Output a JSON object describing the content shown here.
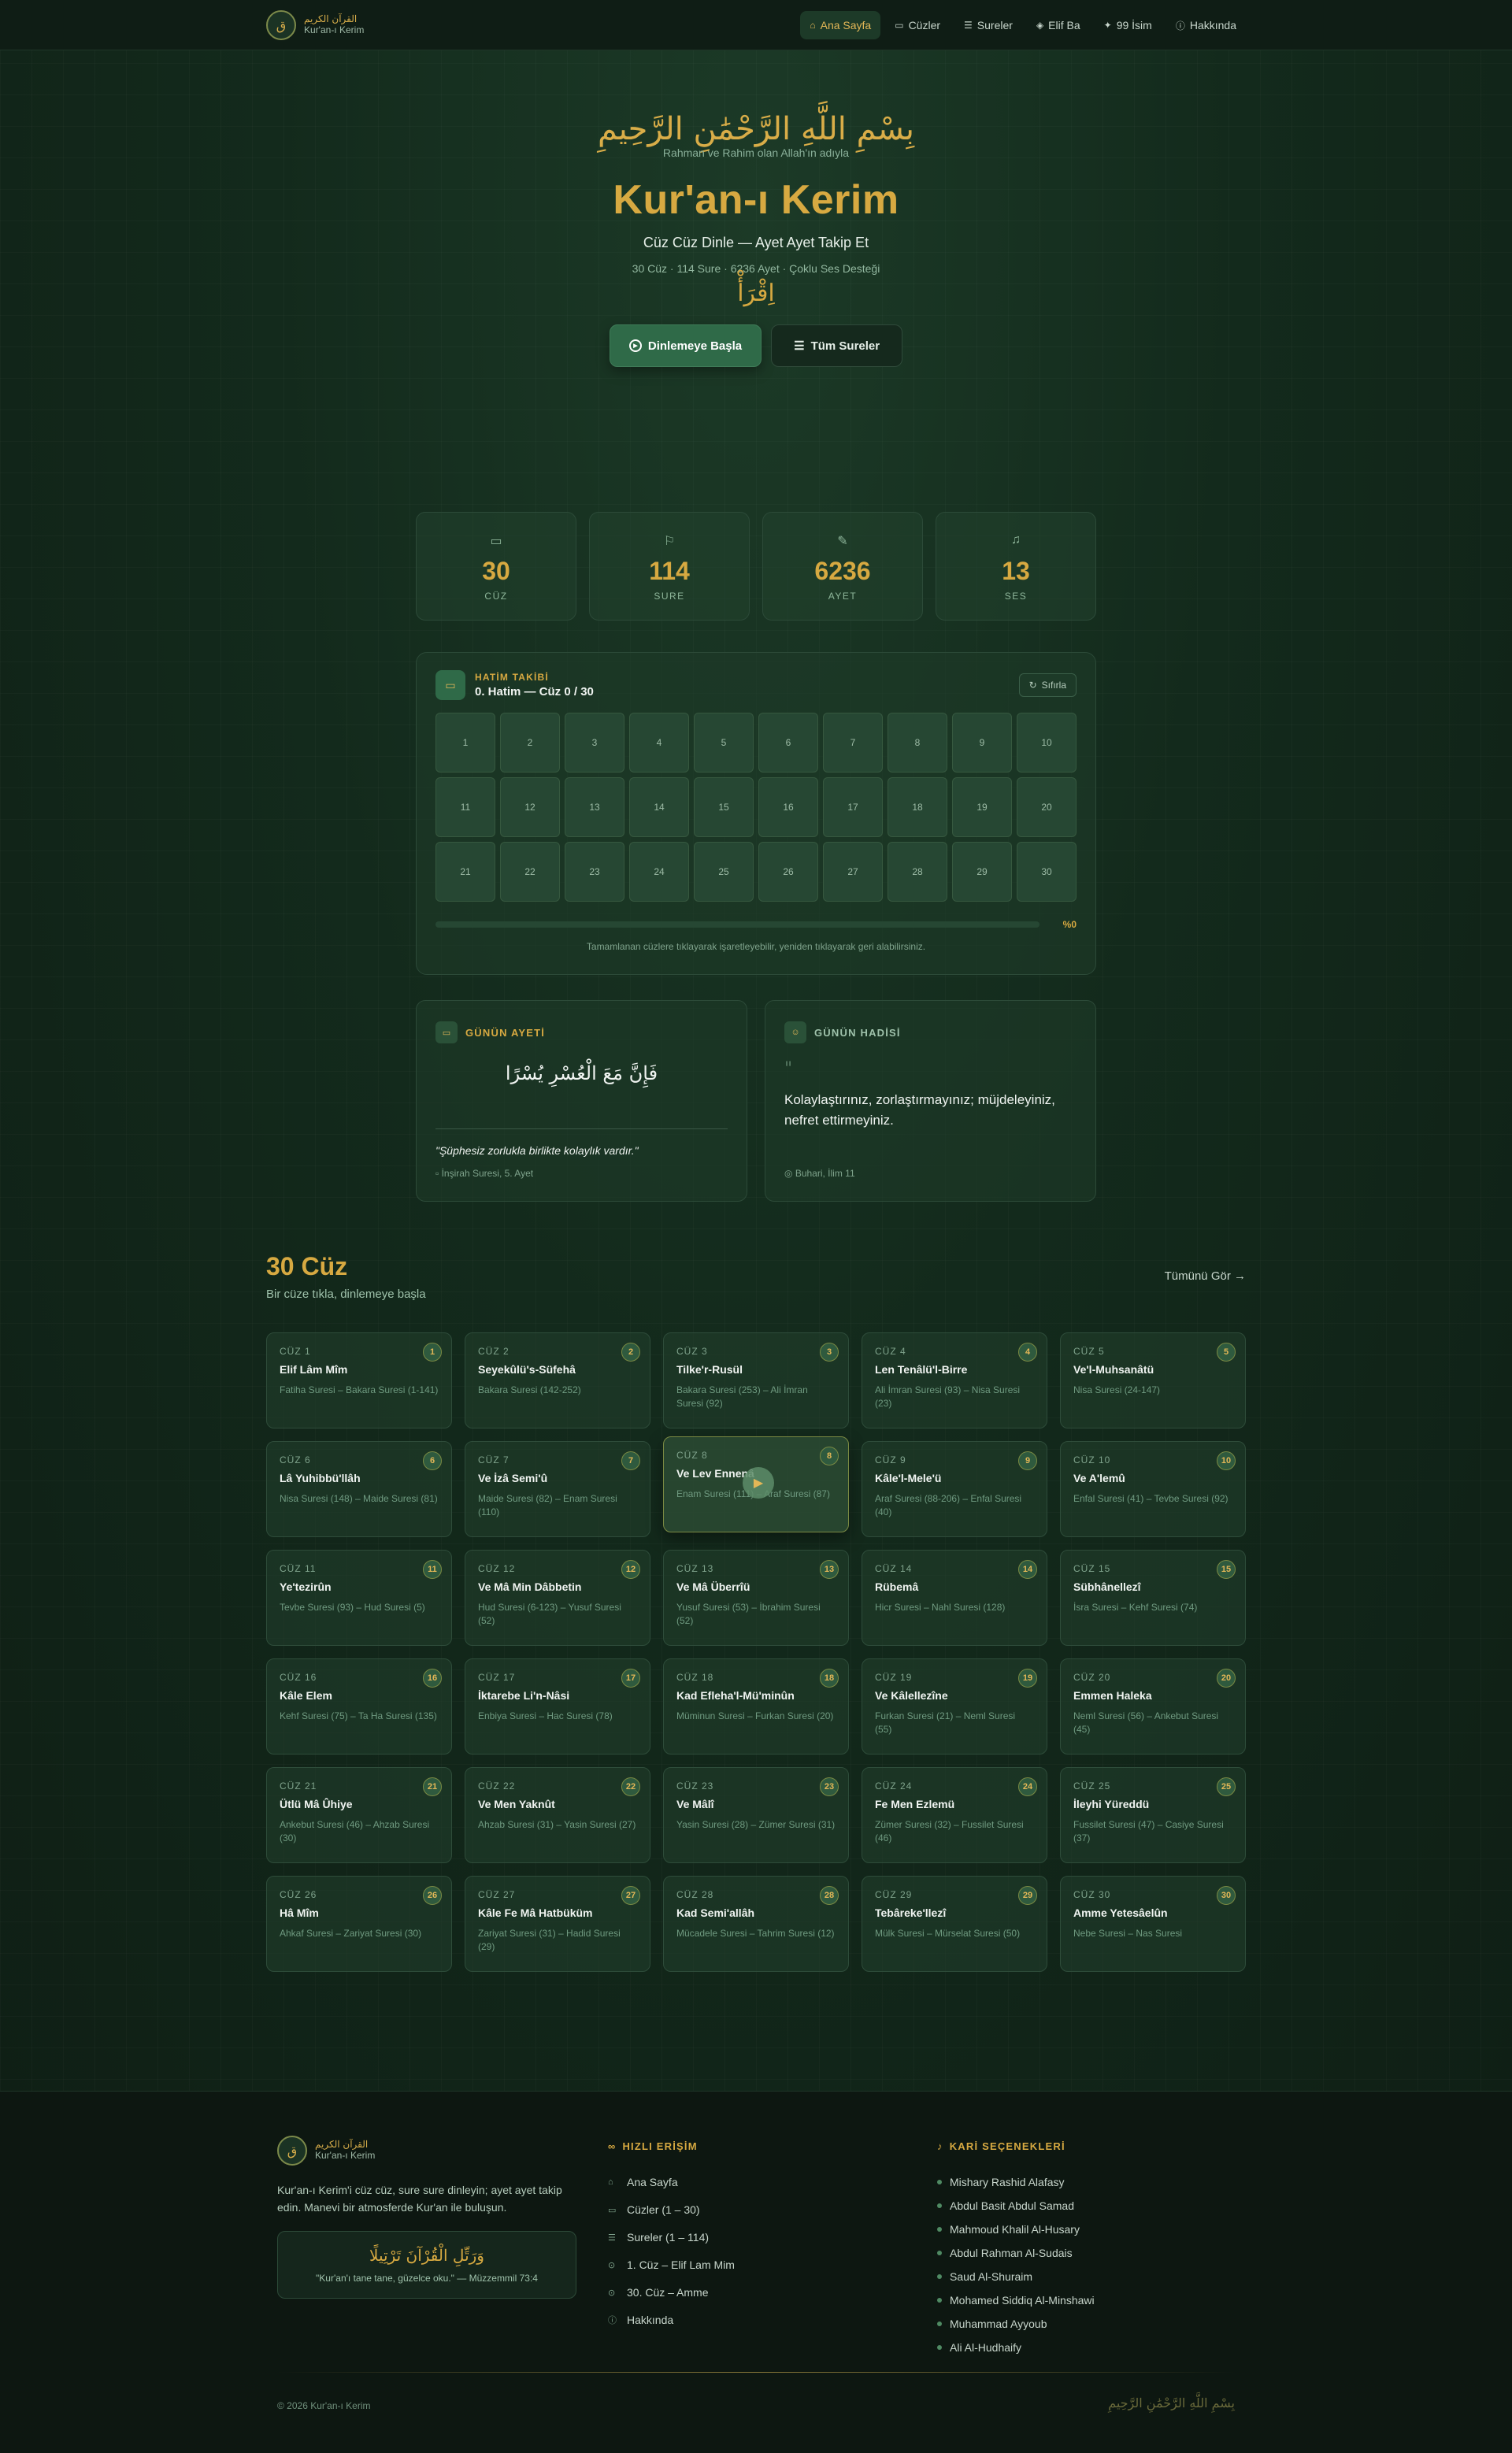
{
  "nav": {
    "brand_ar": "القرآن الكريم",
    "brand_tr": "Kur'an-ı Kerim",
    "logo_letter": "ق",
    "links": [
      {
        "label": "Ana Sayfa",
        "icon": "home-icon",
        "active": true
      },
      {
        "label": "Cüzler",
        "icon": "book-icon"
      },
      {
        "label": "Sureler",
        "icon": "list-icon"
      },
      {
        "label": "Elif Ba",
        "icon": "grad-cap-icon"
      },
      {
        "label": "99 İsim",
        "icon": "sparkles-icon"
      },
      {
        "label": "Hakkında",
        "icon": "info-icon"
      }
    ]
  },
  "hero": {
    "bismillah": "بِسْمِ اللَّهِ الرَّحْمَٰنِ الرَّحِيمِ",
    "bismillah_tr": "Rahman ve Rahim olan Allah'ın adıyla",
    "title": "Kur'an-ı Kerim",
    "subtitle": "Cüz Cüz Dinle — Ayet Ayet Takip Et",
    "stats_line": "30 Cüz · 114 Sure · 6236 Ayet · Çoklu Ses Desteği",
    "iqra": "اِقْرَأْ",
    "primary_button": "Dinlemeye Başla",
    "secondary_button": "Tüm Sureler"
  },
  "stats": [
    {
      "value": "30",
      "label": "CÜZ",
      "icon": "book-open-icon"
    },
    {
      "value": "114",
      "label": "SURE",
      "icon": "bookmark-icon"
    },
    {
      "value": "6236",
      "label": "AYET",
      "icon": "book-edit-icon"
    },
    {
      "value": "13",
      "label": "SES",
      "icon": "microphone-icon"
    }
  ],
  "hatim": {
    "kicker": "HATİM TAKİBİ",
    "title": "0. Hatim — Cüz 0 / 30",
    "reset_label": "Sıfırla",
    "cells": [
      "1",
      "2",
      "3",
      "4",
      "5",
      "6",
      "7",
      "8",
      "9",
      "10",
      "11",
      "12",
      "13",
      "14",
      "15",
      "16",
      "17",
      "18",
      "19",
      "20",
      "21",
      "22",
      "23",
      "24",
      "25",
      "26",
      "27",
      "28",
      "29",
      "30"
    ],
    "progress": 0,
    "progress_text": "%0",
    "hint": "Tamamlanan cüzlere tıklayarak işaretleyebilir, yeniden tıklayarak geri alabilirsiniz."
  },
  "daily_ayah": {
    "kicker": "GÜNÜN AYETİ",
    "arabic": "فَإِنَّ مَعَ الْعُسْرِ يُسْرًا",
    "translation": "\"Şüphesiz zorlukla birlikte kolaylık vardır.\"",
    "reference": "İnşirah Suresi, 5. Ayet"
  },
  "daily_hadith": {
    "kicker": "GÜNÜN HADİSİ",
    "quote_mark": "\"",
    "text": "Kolaylaştırınız, zorlaştırmayınız; müjdeleyiniz, nefret ettirmeyiniz.",
    "reference": "Buhari, İlim 11"
  },
  "juz_section": {
    "title": "30 Cüz",
    "subtitle": "Bir cüze tıkla, dinlemeye başla",
    "see_all": "Tümünü Gör →",
    "items": [
      {
        "label": "CÜZ 1",
        "num": "1",
        "name": "Elif Lâm Mîm",
        "range": "Fatiha Suresi – Bakara Suresi (1-141)"
      },
      {
        "label": "CÜZ 2",
        "num": "2",
        "name": "Seyekûlü's-Süfehâ",
        "range": "Bakara Suresi (142-252)"
      },
      {
        "label": "CÜZ 3",
        "num": "3",
        "name": "Tilke'r-Rusül",
        "range": "Bakara Suresi (253) – Ali İmran Suresi (92)"
      },
      {
        "label": "CÜZ 4",
        "num": "4",
        "name": "Len Tenâlü'l-Birre",
        "range": "Ali İmran Suresi (93) – Nisa Suresi (23)"
      },
      {
        "label": "CÜZ 5",
        "num": "5",
        "name": "Ve'l-Muhsanâtü",
        "range": "Nisa Suresi (24-147)"
      },
      {
        "label": "CÜZ 6",
        "num": "6",
        "name": "Lâ Yuhibbü'llâh",
        "range": "Nisa Suresi (148) – Maide Suresi (81)"
      },
      {
        "label": "CÜZ 7",
        "num": "7",
        "name": "Ve İzâ Semi'û",
        "range": "Maide Suresi (82) – Enam Suresi (110)"
      },
      {
        "label": "CÜZ 8",
        "num": "8",
        "name": "Ve Lev Ennenâ",
        "range": "Enam Suresi (111) – Araf Suresi (87)"
      },
      {
        "label": "CÜZ 9",
        "num": "9",
        "name": "Kâle'l-Mele'ü",
        "range": "Araf Suresi (88-206) – Enfal Suresi (40)"
      },
      {
        "label": "CÜZ 10",
        "num": "10",
        "name": "Ve A'lemû",
        "range": "Enfal Suresi (41) – Tevbe Suresi (92)"
      },
      {
        "label": "CÜZ 11",
        "num": "11",
        "name": "Ye'tezirûn",
        "range": "Tevbe Suresi (93) – Hud Suresi (5)"
      },
      {
        "label": "CÜZ 12",
        "num": "12",
        "name": "Ve Mâ Min Dâbbetin",
        "range": "Hud Suresi (6-123) – Yusuf Suresi (52)"
      },
      {
        "label": "CÜZ 13",
        "num": "13",
        "name": "Ve Mâ Überrîü",
        "range": "Yusuf Suresi (53) – İbrahim Suresi (52)"
      },
      {
        "label": "CÜZ 14",
        "num": "14",
        "name": "Rübemâ",
        "range": "Hicr Suresi – Nahl Suresi (128)"
      },
      {
        "label": "CÜZ 15",
        "num": "15",
        "name": "Sübhânellezî",
        "range": "İsra Suresi – Kehf Suresi (74)"
      },
      {
        "label": "CÜZ 16",
        "num": "16",
        "name": "Kâle Elem",
        "range": "Kehf Suresi (75) – Ta Ha Suresi (135)"
      },
      {
        "label": "CÜZ 17",
        "num": "17",
        "name": "İktarebe Li'n-Nâsi",
        "range": "Enbiya Suresi – Hac Suresi (78)"
      },
      {
        "label": "CÜZ 18",
        "num": "18",
        "name": "Kad Efleha'l-Mü'minûn",
        "range": "Müminun Suresi – Furkan Suresi (20)"
      },
      {
        "label": "CÜZ 19",
        "num": "19",
        "name": "Ve Kâlellezîne",
        "range": "Furkan Suresi (21) – Neml Suresi (55)"
      },
      {
        "label": "CÜZ 20",
        "num": "20",
        "name": "Emmen Haleka",
        "range": "Neml Suresi (56) – Ankebut Suresi (45)"
      },
      {
        "label": "CÜZ 21",
        "num": "21",
        "name": "Ütlü Mâ Ûhiye",
        "range": "Ankebut Suresi (46) – Ahzab Suresi (30)"
      },
      {
        "label": "CÜZ 22",
        "num": "22",
        "name": "Ve Men Yaknût",
        "range": "Ahzab Suresi (31) – Yasin Suresi (27)"
      },
      {
        "label": "CÜZ 23",
        "num": "23",
        "name": "Ve Mâlî",
        "range": "Yasin Suresi (28) – Zümer Suresi (31)"
      },
      {
        "label": "CÜZ 24",
        "num": "24",
        "name": "Fe Men Ezlemü",
        "range": "Zümer Suresi (32) – Fussilet Suresi (46)"
      },
      {
        "label": "CÜZ 25",
        "num": "25",
        "name": "İleyhi Yüreddü",
        "range": "Fussilet Suresi (47) – Casiye Suresi (37)"
      },
      {
        "label": "CÜZ 26",
        "num": "26",
        "name": "Hâ Mîm",
        "range": "Ahkaf Suresi – Zariyat Suresi (30)"
      },
      {
        "label": "CÜZ 27",
        "num": "27",
        "name": "Kâle Fe Mâ Hatbüküm",
        "range": "Zariyat Suresi (31) – Hadid Suresi (29)"
      },
      {
        "label": "CÜZ 28",
        "num": "28",
        "name": "Kad Semi'allâh",
        "range": "Mücadele Suresi – Tahrim Suresi (12)"
      },
      {
        "label": "CÜZ 29",
        "num": "29",
        "name": "Tebâreke'llezî",
        "range": "Mülk Suresi – Mürselat Suresi (50)"
      },
      {
        "label": "CÜZ 30",
        "num": "30",
        "name": "Amme Yetesâelûn",
        "range": "Nebe Suresi – Nas Suresi"
      }
    ]
  },
  "footer": {
    "brand_ar": "القرآن الكريم",
    "brand_tr": "Kur'an-ı Kerim",
    "description": "Kur'an-ı Kerim'i cüz cüz, sure sure dinleyin; ayet ayet takip edin. Manevi bir atmosferde Kur'an ile buluşun.",
    "verse_ar": "وَرَتِّلِ الْقُرْآنَ تَرْتِيلًا",
    "verse_tr": "\"Kur'an'ı tane tane, güzelce oku.\" — Müzzemmil 73:4",
    "quick_title": "HIZLI ERİŞİM",
    "quick_links": [
      {
        "label": "Ana Sayfa",
        "icon": "home-icon"
      },
      {
        "label": "Cüzler (1 – 30)",
        "icon": "book-icon"
      },
      {
        "label": "Sureler (1 – 114)",
        "icon": "list-icon"
      },
      {
        "label": "1. Cüz – Elif Lam Mim",
        "icon": "play-circle-icon"
      },
      {
        "label": "30. Cüz – Amme",
        "icon": "play-circle-icon"
      },
      {
        "label": "Hakkında",
        "icon": "info-icon"
      }
    ],
    "reciters_title": "KARİ SEÇENEKLERİ",
    "reciters": [
      "Mishary Rashid Alafasy",
      "Abdul Basit Abdul Samad",
      "Mahmoud Khalil Al-Husary",
      "Abdul Rahman Al-Sudais",
      "Saud Al-Shuraim",
      "Mohamed Siddiq Al-Minshawi",
      "Muhammad Ayyoub",
      "Ali Al-Hudhaify"
    ],
    "copyright": "© 2026 Kur'an-ı Kerim",
    "bismillah_small": "بِسْمِ اللَّهِ الرَّحْمَٰنِ الرَّحِيمِ"
  },
  "colors": {
    "accent": "#d7a941",
    "primary": "#2f6a48",
    "bg": "#12261a"
  }
}
